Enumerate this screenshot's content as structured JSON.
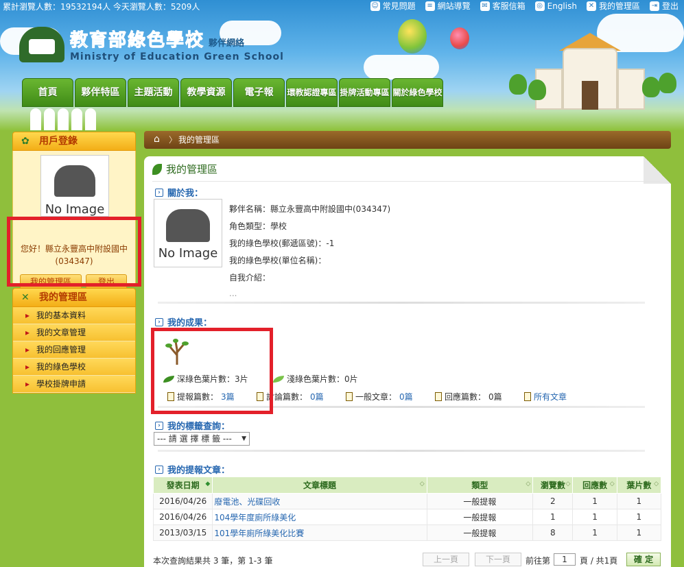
{
  "topbar": {
    "stats": "累計瀏覽人數：19532194人 今天瀏覽人數：5209人",
    "links": [
      {
        "label": "常見問題",
        "icon": "people-icon"
      },
      {
        "label": "網站導覽",
        "icon": "sitemap-icon"
      },
      {
        "label": "客服信箱",
        "icon": "mail-icon"
      },
      {
        "label": "English",
        "icon": "globe-icon"
      },
      {
        "label": "我的管理區",
        "icon": "tools-icon"
      },
      {
        "label": "登出",
        "icon": "logout-icon"
      }
    ]
  },
  "logo": {
    "title": "教育部綠色學校",
    "sub": "夥伴網絡",
    "en": "Ministry of Education Green School"
  },
  "nav": [
    "首頁",
    "夥伴特區",
    "主題活動",
    "教學資源",
    "電子報",
    "環教認證專區",
    "掛牌活動專區",
    "關於綠色學校"
  ],
  "sidebar": {
    "login_title": "用戶登錄",
    "no_image": "No Image",
    "greeting": "您好！縣立永豐高中附設國中(034347)",
    "btn_manage": "我的管理區",
    "btn_logout": "登出",
    "menu_title": "我的管理區",
    "menu": [
      "我的基本資料",
      "我的文章管理",
      "我的回應管理",
      "我的綠色學校",
      "學校掛牌申請"
    ]
  },
  "breadcrumb": {
    "current": "我的管理區"
  },
  "main": {
    "title": "我的管理區",
    "about_title": "關於我：",
    "no_image": "No Image",
    "info": [
      "夥伴名稱：縣立永豐高中附設國中(034347)",
      "角色類型：學校",
      "我的綠色學校(郵遞區號)：-1",
      "我的綠色學校(單位名稱)：",
      "自我介紹：",
      "..."
    ],
    "achv_title": "我的成果：",
    "dark_leaf": "深綠色葉片數：3片",
    "light_leaf": "淺綠色葉片數：0片",
    "counts": [
      {
        "label": "提報篇數：",
        "value": "3篇"
      },
      {
        "label": "討論篇數：",
        "value": "0篇"
      },
      {
        "label": "一般文章：",
        "value": "0篇"
      },
      {
        "label": "回應篇數：",
        "value": "0篇"
      }
    ],
    "all_articles": "所有文章",
    "tag_title": "我的標籤查詢：",
    "tag_select": "--- 請 選 擇 標 籤 ---",
    "report_title": "我的提報文章：",
    "table": {
      "headers": [
        "發表日期",
        "文章標題",
        "類型",
        "瀏覽數",
        "回應數",
        "葉片數"
      ],
      "rows": [
        [
          "2016/04/26",
          "廢電池、光碟回收",
          "一般提報",
          "2",
          "1",
          "1"
        ],
        [
          "2016/04/26",
          "104學年度廁所綠美化",
          "一般提報",
          "1",
          "1",
          "1"
        ],
        [
          "2013/03/15",
          "101學年廁所綠美化比賽",
          "一般提報",
          "8",
          "1",
          "1"
        ]
      ]
    },
    "result_summary": "本次查詢結果共 3 筆，第 1-3 筆",
    "prev": "上一頁",
    "next": "下一頁",
    "goto": "前往第",
    "page_value": "1",
    "page_total": "頁 / 共1頁",
    "confirm": "確 定"
  }
}
